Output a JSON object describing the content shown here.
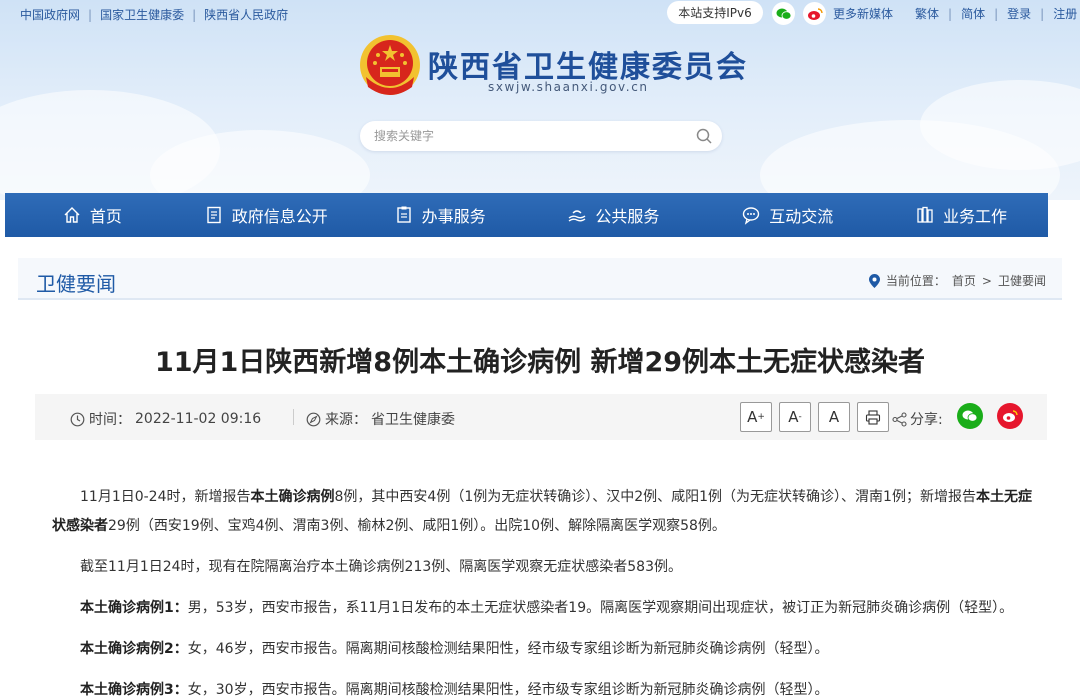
{
  "topbar": {
    "links": [
      "中国政府网",
      "国家卫生健康委",
      "陕西省人民政府"
    ],
    "ipv6_label": "本站支持IPv6",
    "more_media": "更多新媒体",
    "traditional": "繁体",
    "simplified": "简体",
    "login": "登录",
    "register": "注册"
  },
  "header": {
    "title": "陕西省卫生健康委员会",
    "domain": "sxwjw.shaanxi.gov.cn"
  },
  "search": {
    "placeholder": "搜索关键字"
  },
  "nav": {
    "items": [
      {
        "label": "首页",
        "icon": "home-icon"
      },
      {
        "label": "政府信息公开",
        "icon": "document-icon"
      },
      {
        "label": "办事服务",
        "icon": "clipboard-icon"
      },
      {
        "label": "公共服务",
        "icon": "hands-icon"
      },
      {
        "label": "互动交流",
        "icon": "chat-icon"
      },
      {
        "label": "业务工作",
        "icon": "books-icon"
      }
    ]
  },
  "section": {
    "title": "卫健要闻",
    "location_label": "当前位置：",
    "breadcrumb": [
      "首页",
      "卫健要闻"
    ],
    "breadcrumb_sep": ">"
  },
  "article": {
    "title": "11月1日陕西新增8例本土确诊病例 新增29例本土无症状感染者",
    "time_label": "时间：",
    "time": "2022-11-02 09:16",
    "source_label": "来源：",
    "source": "省卫生健康委",
    "share_label": "分享:",
    "font_buttons": [
      "A+",
      "A-",
      "A"
    ],
    "paragraphs": [
      {
        "p1": "11月1日0-24时，新增报告",
        "b1": "本土确诊病例",
        "p2": "8例，其中西安4例（1例为无症状转确诊）、汉中2例、咸阳1例（为无症状转确诊）、渭南1例；新增报告",
        "b2": "本土无症状感染者",
        "p3": "29例（西安19例、宝鸡4例、渭南3例、榆林2例、咸阳1例）。出院10例、解除隔离医学观察58例。"
      },
      {
        "text": "截至11月1日24时，现有在院隔离治疗本土确诊病例213例、隔离医学观察无症状感染者583例。"
      },
      {
        "bold": "本土确诊病例1：",
        "text": "男，53岁，西安市报告，系11月1日发布的本土无症状感染者19。隔离医学观察期间出现症状，被订正为新冠肺炎确诊病例（轻型）。"
      },
      {
        "bold": "本土确诊病例2：",
        "text": "女，46岁，西安市报告。隔离期间核酸检测结果阳性，经市级专家组诊断为新冠肺炎确诊病例（轻型）。"
      },
      {
        "bold": "本土确诊病例3：",
        "text": "女，30岁，西安市报告。隔离期间核酸检测结果阳性，经市级专家组诊断为新冠肺炎确诊病例（轻型）。"
      }
    ]
  },
  "colors": {
    "nav_blue": "#2563ad",
    "title_blue": "#1f4f9a",
    "emblem_red": "#d7261c",
    "emblem_gold": "#f2c230",
    "wechat_green": "#1aad19",
    "weibo_red": "#e6162d"
  }
}
